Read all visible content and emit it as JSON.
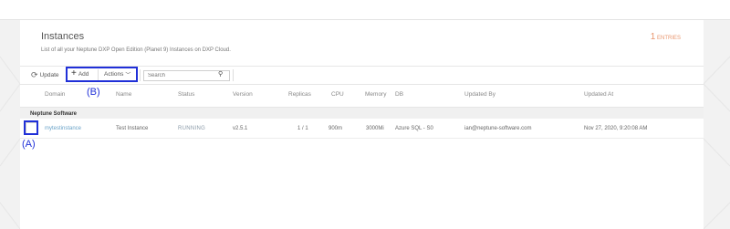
{
  "header": {
    "title": "Instances",
    "subtitle": "List of all your Neptune DXP Open Edition (Planet 9) Instances on DXP Cloud.",
    "entries_count": "1",
    "entries_label": "ENTRIES"
  },
  "toolbar": {
    "update_label": "Update",
    "add_label": "Add",
    "actions_label": "Actions",
    "search_placeholder": "Search"
  },
  "annotations": {
    "a_label": "(A)",
    "b_label": "(B)",
    "highlight_color": "#2030d8"
  },
  "table": {
    "columns": [
      "Domain",
      "Name",
      "Status",
      "Version",
      "Replicas",
      "CPU",
      "Memory",
      "DB",
      "Updated By",
      "Updated At"
    ],
    "group": "Neptune Software",
    "rows": [
      {
        "domain": "mytestinstance",
        "name": "Test Instance",
        "status": "RUNNING",
        "version": "v2.5.1",
        "replicas": "1 / 1",
        "cpu": "900m",
        "memory": "3000Mi",
        "db": "Azure SQL - S0",
        "updated_by": "ian@neptune-software.com",
        "updated_at": "Nov 27, 2020, 9:20:08 AM"
      }
    ]
  },
  "colors": {
    "accent": "#e8956d",
    "link": "#6aa3c8"
  }
}
